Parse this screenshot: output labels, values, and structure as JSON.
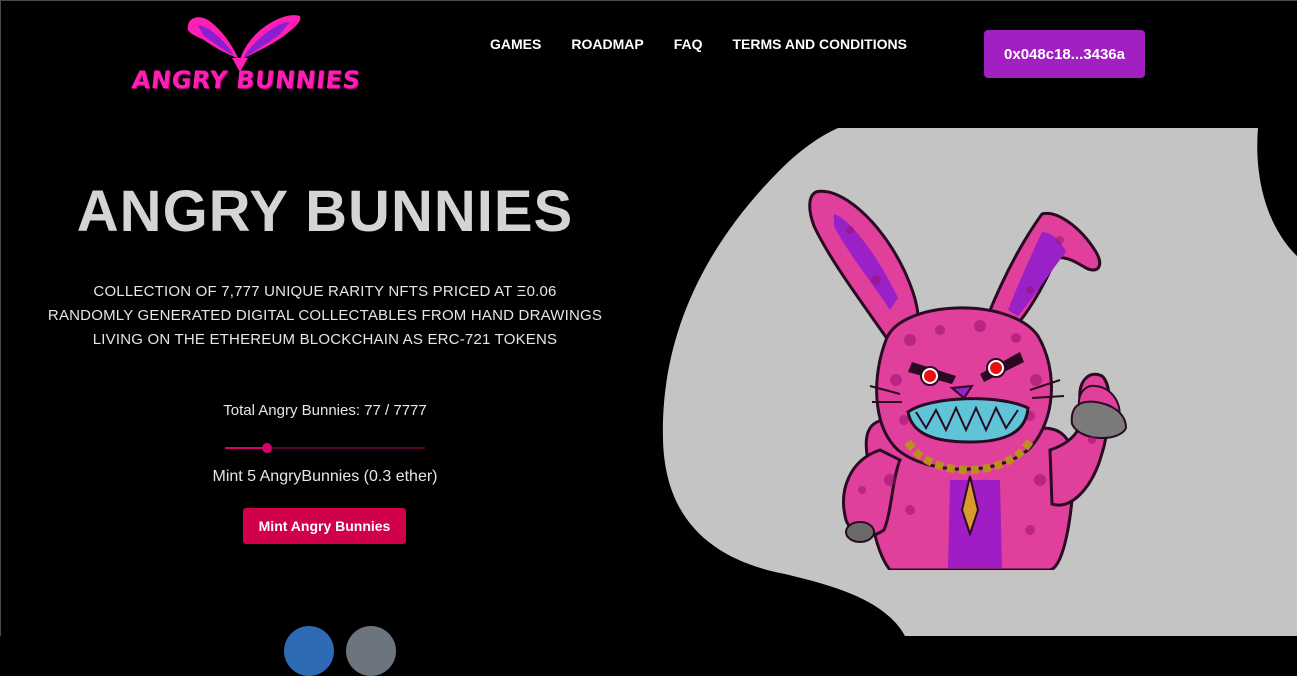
{
  "brand": {
    "logo_text": "ANGRY BUNNIES"
  },
  "nav": {
    "items": [
      "GAMES",
      "ROADMAP",
      "FAQ",
      "TERMS AND CONDITIONS"
    ]
  },
  "wallet": {
    "address": "0x048c18...3436a"
  },
  "hero": {
    "title": "ANGRY BUNNIES",
    "description": [
      "COLLECTION OF 7,777 UNIQUE RARITY NFTS PRICED AT Ξ0.06",
      "RANDOMLY GENERATED DIGITAL COLLECTABLES FROM HAND DRAWINGS",
      "LIVING ON THE ETHEREUM BLOCKCHAIN AS ERC-721 TOKENS"
    ],
    "total": "Total Angry Bunnies: 77 / 7777",
    "mint_label": "Mint 5 AngryBunnies (0.3 ether)",
    "mint_button": "Mint Angry Bunnies"
  },
  "mint_slider": {
    "value": 5,
    "min": 1,
    "max": 20
  },
  "colors": {
    "wallet_button": "#a21fc2",
    "mint_button": "#d1004a",
    "accent_pink": "#ff1fb4",
    "blob": "#c4c4c4"
  }
}
